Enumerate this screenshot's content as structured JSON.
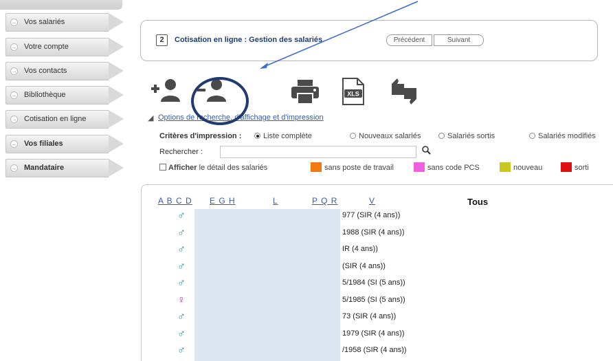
{
  "sidebar": {
    "items": [
      {
        "label": "Vos salariés",
        "bold": false
      },
      {
        "label": "Votre compte",
        "bold": false
      },
      {
        "label": "Vos contacts",
        "bold": false
      },
      {
        "label": "Bibliothèque",
        "bold": false
      },
      {
        "label": "Cotisation en ligne",
        "bold": false
      },
      {
        "label": "Vos filiales",
        "bold": true
      },
      {
        "label": "Mandataire",
        "bold": true
      }
    ]
  },
  "header": {
    "icon_text": "2",
    "title": "Cotisation en ligne : Gestion des salariés",
    "prev_label": "Précédent",
    "next_label": "Suivant"
  },
  "toolbar": {
    "icons": [
      "add-person-icon",
      "remove-person-icon",
      "print-icon",
      "xls-icon",
      "thumbs-icon"
    ],
    "xls_text": "XLS"
  },
  "options": {
    "link_label": "Options de recherche, d'affichage et d'impression"
  },
  "criteria": {
    "label": "Critères d'impression :",
    "options": [
      {
        "label": "Liste complète",
        "selected": true
      },
      {
        "label": "Nouveaux salariés",
        "selected": false
      },
      {
        "label": "Salariés sortis",
        "selected": false
      },
      {
        "label": "Salariés modifiés",
        "selected": false
      }
    ]
  },
  "search": {
    "label": "Rechercher :",
    "value": "",
    "placeholder": ""
  },
  "detail": {
    "checkbox_bold": "Afficher",
    "checkbox_rest": "le détail des salariés",
    "checked": false
  },
  "legend": [
    {
      "label": "sans poste de travail",
      "color": "#f07a10"
    },
    {
      "label": "sans code PCS",
      "color": "#f060e0"
    },
    {
      "label": "nouveau",
      "color": "#c8c820"
    },
    {
      "label": "sorti",
      "color": "#e01010"
    }
  ],
  "alphabet": {
    "groups": [
      "A B C D",
      "E G H",
      "L",
      "P Q R",
      "V"
    ],
    "all_label": "Tous"
  },
  "employees": [
    {
      "sex": "male",
      "text": "977 (SIR (4 ans))"
    },
    {
      "sex": "male",
      "text": "1988 (SIR (4 ans))"
    },
    {
      "sex": "male",
      "text": "IR (4 ans))"
    },
    {
      "sex": "male",
      "text": "(SIR (4 ans))"
    },
    {
      "sex": "male",
      "text": "5/1984 (SI (5 ans))"
    },
    {
      "sex": "female",
      "text": "5/1985 (SI (5 ans))"
    },
    {
      "sex": "male",
      "text": "73 (SIR (4 ans))"
    },
    {
      "sex": "male",
      "text": "1979 (SIR (4 ans))"
    },
    {
      "sex": "male",
      "text": "/1958 (SIR (4 ans))"
    }
  ],
  "colors": {
    "male": "#2a8a8a",
    "female": "#b030a8",
    "annotation": "#1f3b6f",
    "arrow": "#3a6bd0",
    "link": "#3a5da8"
  }
}
